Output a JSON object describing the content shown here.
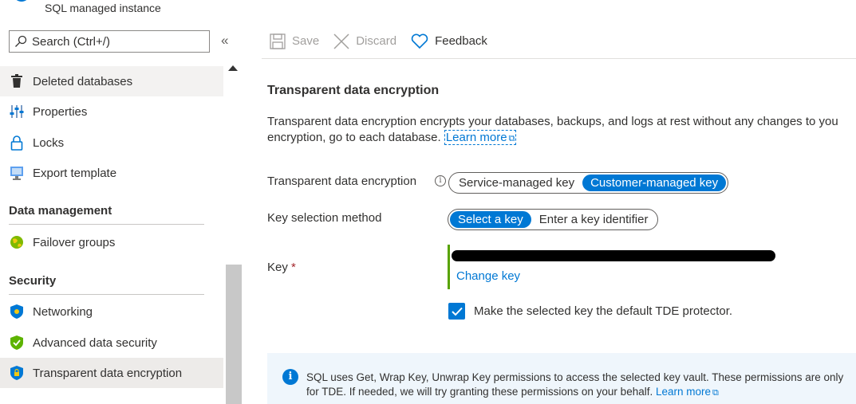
{
  "header": {
    "resource_type": "SQL managed instance"
  },
  "search": {
    "placeholder": "Search (Ctrl+/)"
  },
  "nav": {
    "collapse_glyph": "«",
    "items_top": [
      {
        "label": "Deleted databases",
        "icon": "trash-icon"
      },
      {
        "label": "Properties",
        "icon": "properties-icon"
      },
      {
        "label": "Locks",
        "icon": "lock-icon"
      },
      {
        "label": "Export template",
        "icon": "export-template-icon"
      }
    ],
    "sections": [
      {
        "title": "Data management",
        "items": [
          {
            "label": "Failover groups",
            "icon": "globe-icon"
          }
        ]
      },
      {
        "title": "Security",
        "items": [
          {
            "label": "Networking",
            "icon": "shield-icon"
          },
          {
            "label": "Advanced data security",
            "icon": "shield-check-icon"
          },
          {
            "label": "Transparent data encryption",
            "icon": "shield-lock-icon",
            "selected": true
          }
        ]
      }
    ]
  },
  "toolbar": {
    "save_label": "Save",
    "discard_label": "Discard",
    "feedback_label": "Feedback"
  },
  "main": {
    "title": "Transparent data encryption",
    "description_line1": "Transparent data encryption encrypts your databases, backups, and logs at rest without any changes to you",
    "description_line2": "encryption, go to each database.",
    "learn_more": "Learn more",
    "tde_label": "Transparent data encryption",
    "tde_options": [
      "Service-managed key",
      "Customer-managed key"
    ],
    "tde_selected": "Customer-managed key",
    "key_method_label": "Key selection method",
    "key_method_options": [
      "Select a key",
      "Enter a key identifier"
    ],
    "key_method_selected": "Select a key",
    "key_label": "Key",
    "required_marker": "*",
    "change_key": "Change key",
    "default_protector_label": "Make the selected key the default TDE protector.",
    "default_protector_checked": true
  },
  "info_bar": {
    "line1": "SQL uses Get, Wrap Key, Unwrap Key permissions to access the selected key vault. These permissions are only",
    "line2": "for TDE. If needed, we will try granting these permissions on your behalf.",
    "learn_more": "Learn more"
  },
  "colors": {
    "accent": "#0078d4",
    "valid_bar": "#57a300",
    "info_bg": "#eff6fc"
  }
}
